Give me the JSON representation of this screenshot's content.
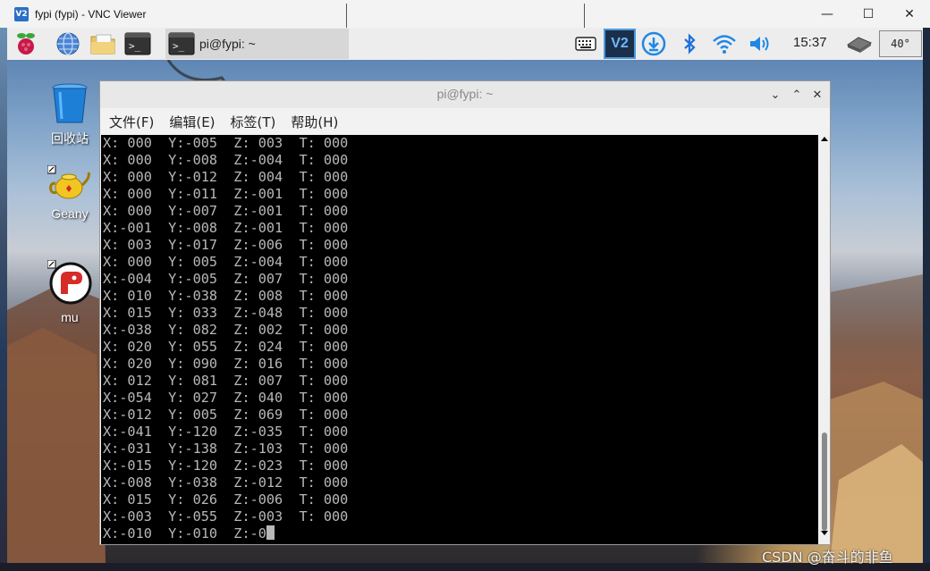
{
  "vnc": {
    "logo": "V2",
    "title": "fypi (fypi) - VNC Viewer",
    "minimize_glyph": "—",
    "maximize_glyph": "☐",
    "close_glyph": "✕"
  },
  "panel": {
    "task_label": "pi@fypi: ~",
    "clock": "15:37",
    "temperature": "40°",
    "vnc_tray_label": "V2"
  },
  "desktop": {
    "icons": [
      {
        "label": "回收站",
        "icon": "trash-icon"
      },
      {
        "label": "Geany",
        "icon": "geany-teapot-icon"
      },
      {
        "label": "mu",
        "icon": "mu-editor-icon"
      }
    ]
  },
  "terminal": {
    "title": "pi@fypi: ~",
    "minimize_glyph": "⌄",
    "maximize_glyph": "⌃",
    "close_glyph": "✕",
    "menu": [
      "文件(F)",
      "编辑(E)",
      "标签(T)",
      "帮助(H)"
    ],
    "lines": [
      "X: 000  Y:-005  Z: 003  T: 000",
      "X: 000  Y:-008  Z:-004  T: 000",
      "X: 000  Y:-012  Z: 004  T: 000",
      "X: 000  Y:-011  Z:-001  T: 000",
      "X: 000  Y:-007  Z:-001  T: 000",
      "X:-001  Y:-008  Z:-001  T: 000",
      "X: 003  Y:-017  Z:-006  T: 000",
      "X: 000  Y: 005  Z:-004  T: 000",
      "X:-004  Y:-005  Z: 007  T: 000",
      "X: 010  Y:-038  Z: 008  T: 000",
      "X: 015  Y: 033  Z:-048  T: 000",
      "X:-038  Y: 082  Z: 002  T: 000",
      "X: 020  Y: 055  Z: 024  T: 000",
      "X: 020  Y: 090  Z: 016  T: 000",
      "X: 012  Y: 081  Z: 007  T: 000",
      "X:-054  Y: 027  Z: 040  T: 000",
      "X:-012  Y: 005  Z: 069  T: 000",
      "X:-041  Y:-120  Z:-035  T: 000",
      "X:-031  Y:-138  Z:-103  T: 000",
      "X:-015  Y:-120  Z:-023  T: 000",
      "X:-008  Y:-038  Z:-012  T: 000",
      "X: 015  Y: 026  Z:-006  T: 000",
      "X:-003  Y:-055  Z:-003  T: 000"
    ],
    "current_line": "X:-010  Y:-010  Z:-0"
  },
  "watermark": "CSDN @奋斗的非鱼"
}
